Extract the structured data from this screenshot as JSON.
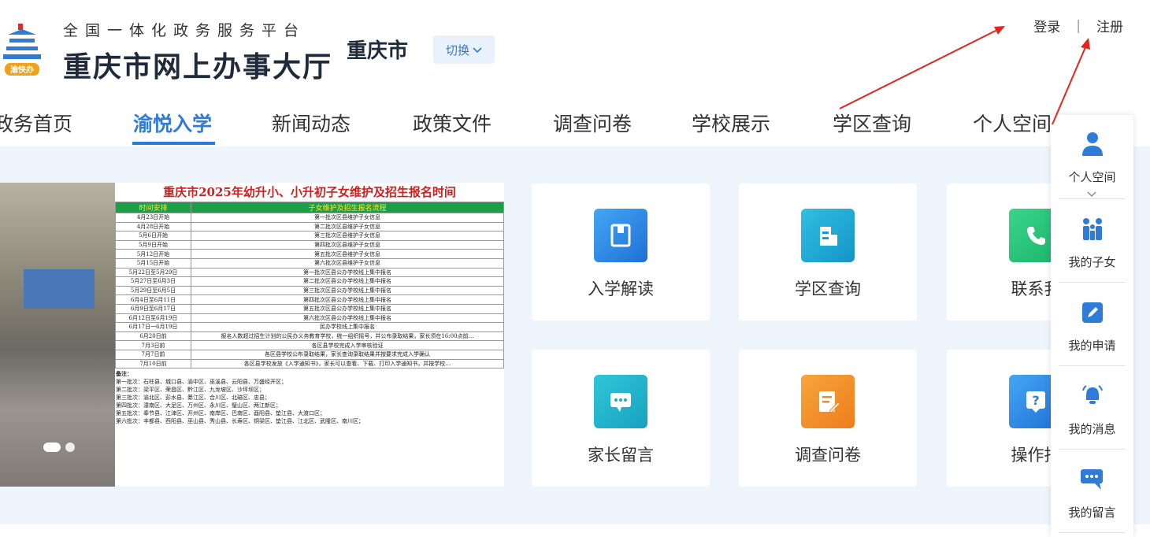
{
  "header": {
    "platform_sub": "全国一体化政务服务平台",
    "platform_main": "重庆市网上办事大厅",
    "logo_badge": "渝快办",
    "city": "重庆市",
    "switch_label": "切换",
    "login": "登录",
    "separator": "|",
    "register": "注册"
  },
  "nav": {
    "items": [
      "政务首页",
      "渝悦入学",
      "新闻动态",
      "政策文件",
      "调查问卷",
      "学校展示",
      "学区查询",
      "个人空间"
    ],
    "active_index": 1
  },
  "banner": {
    "title": "重庆市2025年幼升小、小升初子女维护及招生报名时间",
    "col_time": "时间安排",
    "col_process": "子女维护及招生报名流程",
    "rows": [
      [
        "4月23日开始",
        "第一批次区县维护子女信息"
      ],
      [
        "4月28日开始",
        "第二批次区县维护子女信息"
      ],
      [
        "5月6日开始",
        "第三批次区县维护子女信息"
      ],
      [
        "5月9日开始",
        "第四批次区县维护子女信息"
      ],
      [
        "5月12日开始",
        "第五批次区县维护子女信息"
      ],
      [
        "5月15日开始",
        "第六批次区县维护子女信息"
      ],
      [
        "5月22日至5月29日",
        "第一批次区县公办学校线上集中报名"
      ],
      [
        "5月27日至6月3日",
        "第二批次区县公办学校线上集中报名"
      ],
      [
        "5月29日至6月5日",
        "第三批次区县公办学校线上集中报名"
      ],
      [
        "6月4日至6月11日",
        "第四批次区县公办学校线上集中报名"
      ],
      [
        "6月9日至6月17日",
        "第五批次区县公办学校线上集中报名"
      ],
      [
        "6月12日至6月19日",
        "第六批次区县公办学校线上集中报名"
      ],
      [
        "6月17日一6月19日",
        "民办学校线上集中报名"
      ],
      [
        "6月20日前",
        "报名人数超过招生计划的公民办义务教育学校，统一组织摇号，并公布录取结果，家长须在16:00点前…"
      ],
      [
        "7月3日前",
        "各区县学校完成入学审核验证"
      ],
      [
        "7月7日前",
        "各区县学校公布录取结果，家长查询录取结果并按要求完成入学确认"
      ],
      [
        "7月10日前",
        "各区县学校发放《入学通知书》，家长可以查看、下载、打印入学通知书，并按学校…"
      ]
    ],
    "notes_title": "备注：",
    "notes": [
      "第一批次：石柱县、城口县、渝中区、巫溪县、云阳县、万盛经开区；",
      "第二批次：梁平区、荣昌区、黔江区、九龙坡区、沙坪坝区；",
      "第三批次：渝北区、彭水县、綦江区、合川区、北碚区、忠县；",
      "第四批次：潼南区、大足区、万州区、永川区、璧山区、两江新区；",
      "第五批次：奉节县、江津区、开州区、南岸区、巴南区、酉阳县、垫江县、大渡口区；",
      "第六批次：丰都县、西阳县、巫山县、秀山县、长寿区、铜梁区、垫江县、江北区、武隆区、南川区；"
    ]
  },
  "cards": [
    "入学解读",
    "学区查询",
    "联系我",
    "家长留言",
    "调查问卷",
    "操作指"
  ],
  "float_panel": {
    "items": [
      "个人空间",
      "我的子女",
      "我的申请",
      "我的消息",
      "我的留言"
    ]
  },
  "colors": {
    "brand_blue": "#2f7cd8",
    "content_bg": "#eef5fd",
    "arrow_red": "#e8231d"
  }
}
